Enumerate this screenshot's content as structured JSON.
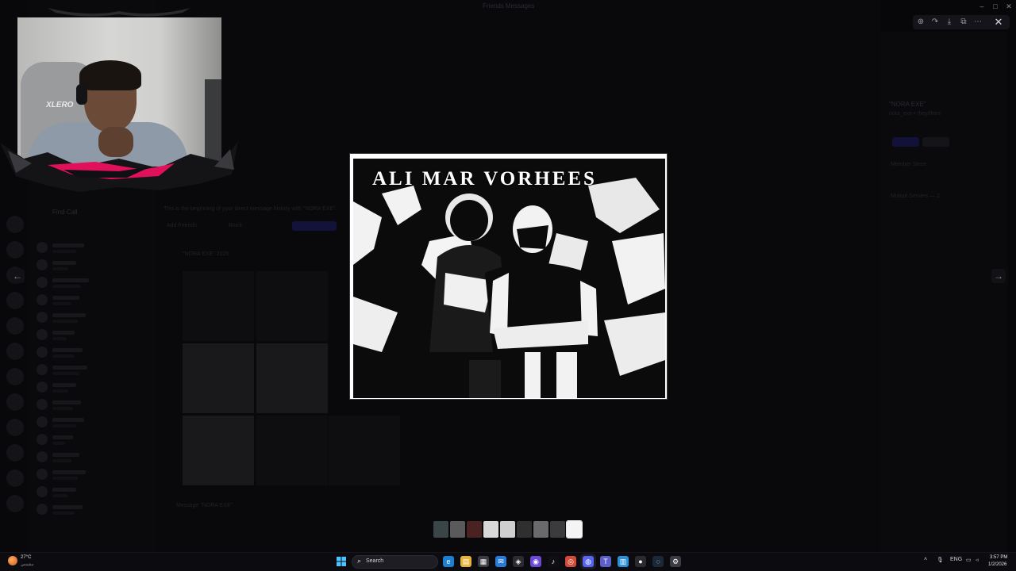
{
  "window": {
    "title": "Friends Messages"
  },
  "background": {
    "dm_header": "Find Call",
    "dm_items": [
      "ᴍᴋ",
      "ʜɪ ʏᴏ ɢᴀᴀ",
      "ᴍᴋ ʀᴏ ɴᴀ",
      "ɢᴀᴀ ɪᴋ",
      "ᴍᴋ ᴏɴ",
      "ᴍᴋ ᴀᴀ"
    ],
    "chat_intro": "This is the beginning of your direct message history with \"NORA EXE\".",
    "chat_actions": [
      "Add Friends",
      "Block",
      "Report Spam"
    ],
    "media_header": "\"NORA EXE\" 2026",
    "message_placeholder": "Message \"NORA EXE\"",
    "profile_name": "\"NORA EXE\"",
    "profile_handle": "nora_exe • they/them",
    "profile_buttons": [
      "Message",
      "Profile"
    ],
    "profile_section": "Member Since",
    "profile_servers": "Mutual Servers — 2"
  },
  "webcam": {
    "chair_brand": "XLERO"
  },
  "lightbox": {
    "image_title": "ALI MAR VORHEES",
    "toolbar_icons": [
      "zoom-in-icon",
      "forward-icon",
      "download-icon",
      "open-external-icon",
      "more-icon"
    ],
    "close_symbol": "✕",
    "prev_arrow": "←",
    "next_arrow": "→",
    "thumbnails": [
      {
        "color": "#3a4548",
        "active": false
      },
      {
        "color": "#5a5a5c",
        "active": false
      },
      {
        "color": "#4a2222",
        "active": false
      },
      {
        "color": "#d8d8d8",
        "active": false
      },
      {
        "color": "#cfcfcf",
        "active": false
      },
      {
        "color": "#2f2f30",
        "active": false
      },
      {
        "color": "#6a6a6c",
        "active": false
      },
      {
        "color": "#3b3b3d",
        "active": false
      },
      {
        "color": "#f4f4f4",
        "active": true
      }
    ]
  },
  "taskbar": {
    "weather_temp": "27°C",
    "weather_desc": "مشمس",
    "search_label": "Search",
    "language": "ENG",
    "time": "3:57 PM",
    "date": "1/2/2026",
    "apps": [
      {
        "name": "edge-icon",
        "color": "#1d7fd1",
        "glyph": "e"
      },
      {
        "name": "file-explorer-icon",
        "color": "#e7b43a",
        "glyph": "▤"
      },
      {
        "name": "store-icon",
        "color": "#3b3b46",
        "glyph": "▦"
      },
      {
        "name": "mail-icon",
        "color": "#2a7ad8",
        "glyph": "✉"
      },
      {
        "name": "roblox-icon",
        "color": "#2b2b30",
        "glyph": "◈"
      },
      {
        "name": "gamepad-icon",
        "color": "#6d4ad6",
        "glyph": "◉"
      },
      {
        "name": "tiktok-icon",
        "color": "#101014",
        "glyph": "♪"
      },
      {
        "name": "chrome-icon",
        "color": "#d14b3a",
        "glyph": "◎"
      },
      {
        "name": "discord-icon",
        "color": "#5865f2",
        "glyph": "◍"
      },
      {
        "name": "teams-icon",
        "color": "#5b5fc7",
        "glyph": "T"
      },
      {
        "name": "notepad-icon",
        "color": "#2b8fd8",
        "glyph": "▥"
      },
      {
        "name": "obs-icon",
        "color": "#2a2a2f",
        "glyph": "●"
      },
      {
        "name": "steam-icon",
        "color": "#1b2838",
        "glyph": "◌"
      },
      {
        "name": "settings-icon",
        "color": "#3b3b46",
        "glyph": "⚙"
      }
    ]
  }
}
